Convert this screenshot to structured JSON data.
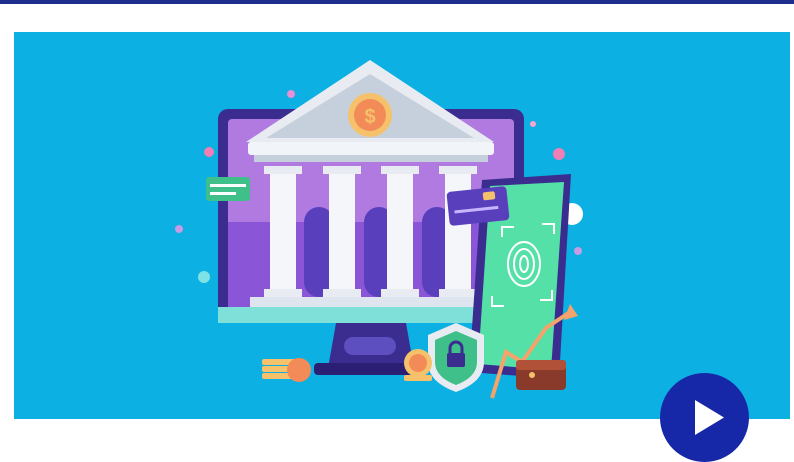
{
  "header": {
    "accent_color": "#1f2d8c"
  },
  "hero": {
    "background_color": "#0cb0e2",
    "coin_symbol": "$"
  },
  "play_button": {
    "color": "#1628a8",
    "icon": "play-icon"
  }
}
